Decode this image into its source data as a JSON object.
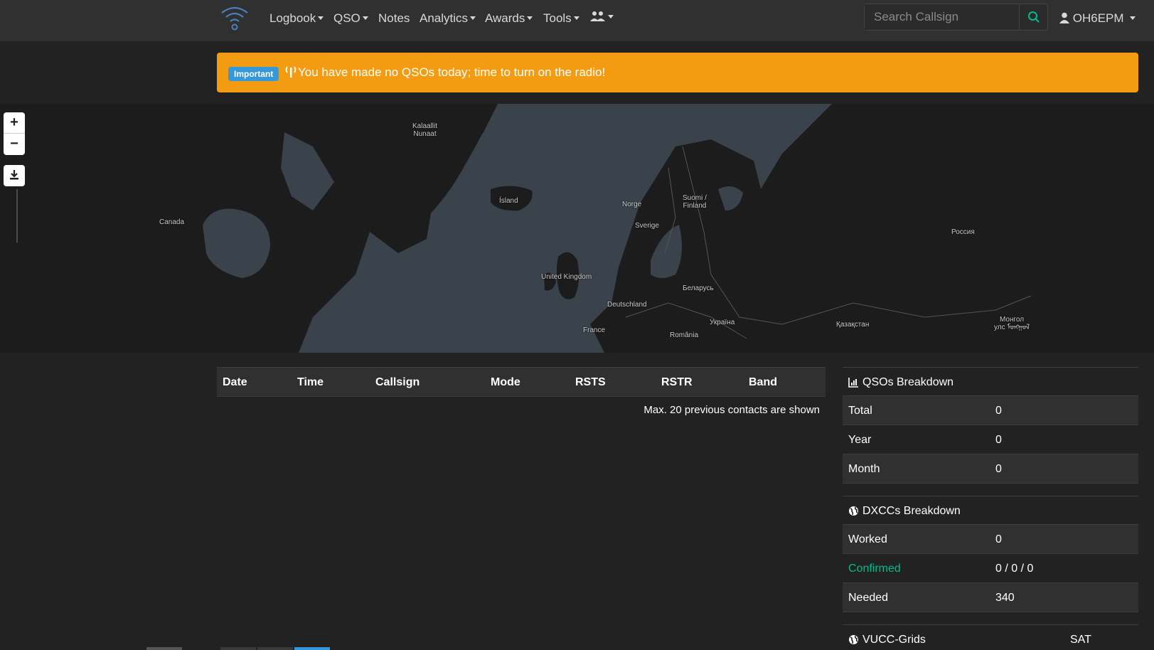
{
  "nav": {
    "items": [
      {
        "label": "Logbook",
        "dropdown": true
      },
      {
        "label": "QSO",
        "dropdown": true
      },
      {
        "label": "Notes",
        "dropdown": false
      },
      {
        "label": "Analytics",
        "dropdown": true
      },
      {
        "label": "Awards",
        "dropdown": true
      },
      {
        "label": "Tools",
        "dropdown": true
      }
    ],
    "community_icon": "users-icon",
    "search_placeholder": "Search Callsign",
    "search_icon": "search-icon",
    "user": "OH6EPM",
    "accent": "#00bc8c"
  },
  "alert": {
    "badge": "Important",
    "icon": "radio-tower-icon",
    "text": "You have made no QSOs today; time to turn on the radio!",
    "background": "#f39c12",
    "badge_color": "#3498db"
  },
  "map": {
    "controls": {
      "zoom_in": "+",
      "zoom_out": "−",
      "download_icon": "download-icon"
    },
    "labels": {
      "greenland": "Kalaallit\nNunaat",
      "iceland": "Ísland",
      "canada": "Canada",
      "norway": "Norge",
      "finland": "Suomi /\nFinland",
      "sweden": "Sverige",
      "russia": "Россия",
      "uk": "United Kingdom",
      "belarus": "Беларусь",
      "germany": "Deutschland",
      "ukraine": "Україна",
      "kazakhstan": "Қазақстан",
      "mongolia": "Монгол\nулс ᠮᠣᠩᠭᠣᠯ",
      "france": "France",
      "romania": "România"
    }
  },
  "table": {
    "columns": [
      "Date",
      "Time",
      "Callsign",
      "Mode",
      "RSTS",
      "RSTR",
      "Band"
    ],
    "rows": [],
    "note": "Max. 20 previous contacts are shown"
  },
  "qsos": {
    "title": "QSOs Breakdown",
    "icon": "chart-icon",
    "rows": [
      {
        "label": "Total",
        "value": "0"
      },
      {
        "label": "Year",
        "value": "0"
      },
      {
        "label": "Month",
        "value": "0"
      }
    ]
  },
  "dxcc": {
    "title": "DXCCs Breakdown",
    "icon": "globe-icon",
    "rows": [
      {
        "label": "Worked",
        "value": "0"
      },
      {
        "label": "Confirmed",
        "value": "0 / 0 / 0"
      },
      {
        "label": "Needed",
        "value": "340"
      }
    ]
  },
  "vucc": {
    "title": "VUCC-Grids",
    "icon": "globe-icon",
    "column": "SAT"
  }
}
